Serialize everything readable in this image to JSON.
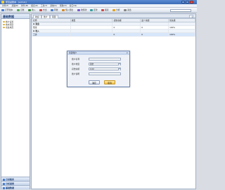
{
  "window": {
    "title": "聚宝盆账本 · [admin]"
  },
  "menu": [
    "文件(F)",
    "基础(B)",
    "财务(M)",
    "报表(R)",
    "工具(T)",
    "系统(S)",
    "帮助(H)",
    "窗口(W)"
  ],
  "toolbar": [
    {
      "label": "打开账本",
      "color": "#4a7fcf"
    },
    {
      "label": "记账",
      "color": "#5aa85a"
    },
    {
      "label": "收入",
      "color": "#3d8c3d"
    },
    {
      "label": "支出",
      "color": "#c94b4b"
    },
    {
      "label": "转账",
      "color": "#4a7fcf"
    },
    {
      "label": "借入借出",
      "color": "#d08a2a"
    },
    {
      "label": "收借款",
      "color": "#7a5ac9"
    },
    {
      "label": "还款",
      "color": "#3aa0a0"
    },
    {
      "label": "报表",
      "color": "#c94b4b"
    },
    {
      "label": "分析",
      "color": "#e0a020"
    },
    {
      "label": "退出",
      "color": "#888888"
    }
  ],
  "sidebar": {
    "title": "基础数据",
    "items": [
      "账户设置",
      "收支项目",
      "家庭成员"
    ],
    "nav": [
      "日常账务",
      "分析报表",
      "基础数据"
    ]
  },
  "main": {
    "tabs": [
      "欢迎",
      "账户",
      "项目"
    ],
    "columns": [
      "名称",
      "类型",
      "初始余额",
      "最少余额",
      "优先级"
    ],
    "rows": [
      {
        "kind": "group",
        "cells": [
          "⊟ 资金",
          "",
          "",
          "",
          ""
        ]
      },
      {
        "kind": "data",
        "cells": [
          "现金",
          "",
          "0",
          "0",
          "100%"
        ]
      },
      {
        "kind": "group",
        "cells": [
          "⊟ 收入",
          "",
          "",
          "",
          ""
        ]
      },
      {
        "kind": "selected",
        "cells": [
          "工资",
          "",
          "0",
          "0",
          "100%"
        ]
      }
    ]
  },
  "dialog": {
    "title": "新建账户",
    "fields": [
      {
        "label": "账户名称",
        "value": ""
      },
      {
        "label": "账户类型",
        "value": "现金"
      },
      {
        "label": "初始余额",
        "value": "0.00"
      },
      {
        "label": "账户说明",
        "value": ""
      }
    ],
    "ok": "确定",
    "cancel": "取消"
  }
}
